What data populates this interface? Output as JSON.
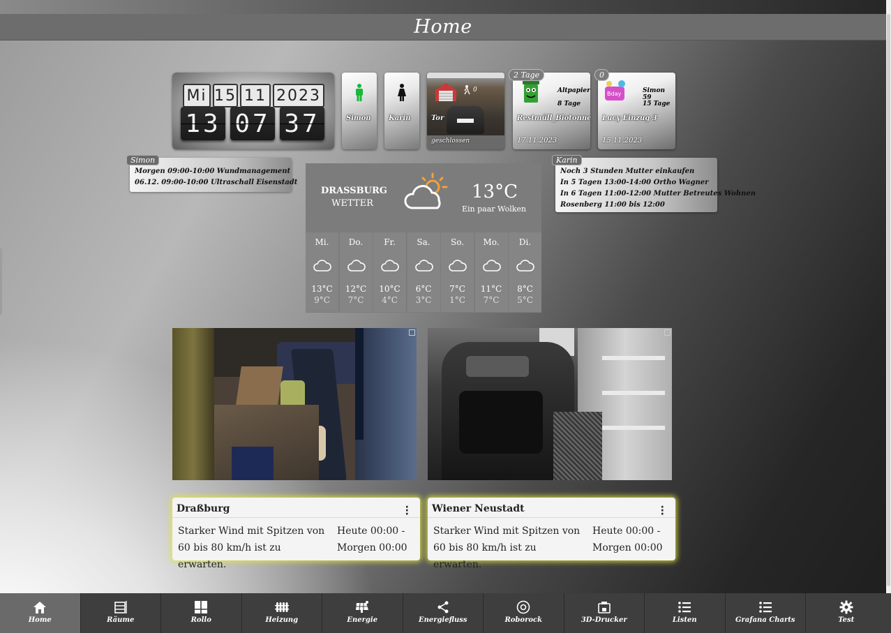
{
  "page": {
    "title": "Home"
  },
  "clock": {
    "weekday": "Mi",
    "day": "15",
    "month": "11",
    "year": "2023",
    "hour": "13",
    "minute": "07",
    "second": "37"
  },
  "tiles": {
    "simon": {
      "label": "Simon"
    },
    "karin": {
      "label": "Karin"
    },
    "tor": {
      "label": "Tor",
      "status": "geschlossen",
      "count": "0"
    },
    "restmuell": {
      "badge": "2 Tage",
      "label": "Restmüll_Biotonne",
      "date": "17.11.2023",
      "side_title": "Altpapier",
      "side_days": "8 Tage"
    },
    "lucy": {
      "badge": "0",
      "label": "Lucy Einzug 3",
      "date": "15.11.2023",
      "side_title": "Simon 59",
      "side_days": "15 Tage"
    }
  },
  "notes_simon": {
    "tag": "Simon",
    "lines": [
      "Morgen 09:00-10:00 Wundmanagement",
      "06.12. 09:00-10:00 Ultraschall Eisenstadt"
    ]
  },
  "notes_karin": {
    "tag": "Karin",
    "lines": [
      "Noch 3 Stunden Mutter einkaufen",
      "In 5 Tagen 13:00-14:00 Ortho Wagner",
      "In 6 Tagen 11:00-12:00 Mutter Betreutes Wohnen",
      "Rosenberg 11:00 bis 12:00"
    ]
  },
  "weather": {
    "city": "DRASSBURG",
    "subtitle": "WETTER",
    "temperature": "13°C",
    "description": "Ein paar Wolken",
    "days": [
      {
        "name": "Mi.",
        "high": "13°C",
        "low": "9°C"
      },
      {
        "name": "Do.",
        "high": "12°C",
        "low": "7°C"
      },
      {
        "name": "Fr.",
        "high": "10°C",
        "low": "4°C"
      },
      {
        "name": "Sa.",
        "high": "6°C",
        "low": "3°C"
      },
      {
        "name": "So.",
        "high": "7°C",
        "low": "1°C"
      },
      {
        "name": "Mo.",
        "high": "11°C",
        "low": "7°C"
      },
      {
        "name": "Di.",
        "high": "8°C",
        "low": "5°C"
      }
    ]
  },
  "warnings": [
    {
      "place": "Draßburg",
      "text": "Starker Wind mit Spitzen von 60 bis 80 km/h ist zu erwarten.",
      "time": "Heute 00:00 - Morgen 00:00"
    },
    {
      "place": "Wiener Neustadt",
      "text": "Starker Wind mit Spitzen von 60 bis 80 km/h ist zu erwarten.",
      "time": "Heute 00:00 - Morgen 00:00"
    }
  ],
  "nav": [
    {
      "label": "Home",
      "icon": "home-icon"
    },
    {
      "label": "Räume",
      "icon": "rooms-icon"
    },
    {
      "label": "Rollo",
      "icon": "blinds-icon"
    },
    {
      "label": "Heizung",
      "icon": "radiator-icon"
    },
    {
      "label": "Energie",
      "icon": "solar-panel-icon"
    },
    {
      "label": "Energiefluss",
      "icon": "share-icon"
    },
    {
      "label": "Roborock",
      "icon": "robot-vacuum-icon"
    },
    {
      "label": "3D-Drucker",
      "icon": "printer-3d-icon"
    },
    {
      "label": "Listen",
      "icon": "list-icon"
    },
    {
      "label": "Grafana Charts",
      "icon": "list-icon"
    },
    {
      "label": "Test",
      "icon": "gear-icon"
    }
  ],
  "colors": {
    "nav_bg": "#3e3e3e",
    "nav_active": "#6a6a6a",
    "warning_glow": "#e2e63c",
    "person_green": "#17b93a"
  }
}
